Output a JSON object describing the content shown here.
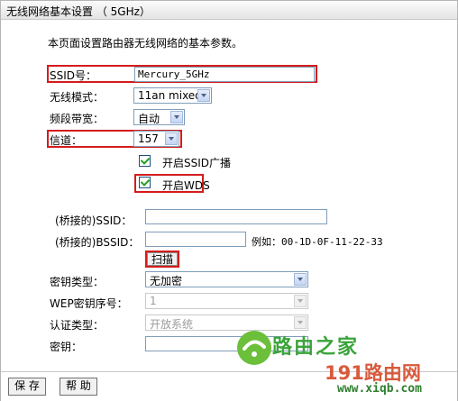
{
  "title": "无线网络基本设置 （ 5GHz）",
  "description": "本页面设置路由器无线网络的基本参数。",
  "ssid": {
    "label": "SSID号：",
    "value": "Mercury_5GHz"
  },
  "mode": {
    "label": "无线模式：",
    "value": "11an mixed"
  },
  "bandwidth": {
    "label": "频段带宽：",
    "value": "自动"
  },
  "channel": {
    "label": "信道：",
    "value": "157"
  },
  "ssid_broadcast": {
    "label": "开启SSID广播",
    "checked": true
  },
  "wds": {
    "label": "开启WDS",
    "checked": true
  },
  "bridge_ssid": {
    "label": "(桥接的)SSID：",
    "value": ""
  },
  "bridge_bssid": {
    "label": "(桥接的)BSSID：",
    "value": "",
    "example": "例如：00-1D-0F-11-22-33"
  },
  "scan_button": "扫描",
  "key_type": {
    "label": "密钥类型：",
    "value": "无加密"
  },
  "wep_index": {
    "label": "WEP密钥序号：",
    "value": "1"
  },
  "auth_type": {
    "label": "认证类型：",
    "value": "开放系统"
  },
  "key": {
    "label": "密钥：",
    "value": ""
  },
  "buttons": {
    "save": "保 存",
    "help": "帮 助"
  },
  "watermark": {
    "line1": "路由之家",
    "line2": "191路由网",
    "line3": "www.xiqb.com"
  }
}
